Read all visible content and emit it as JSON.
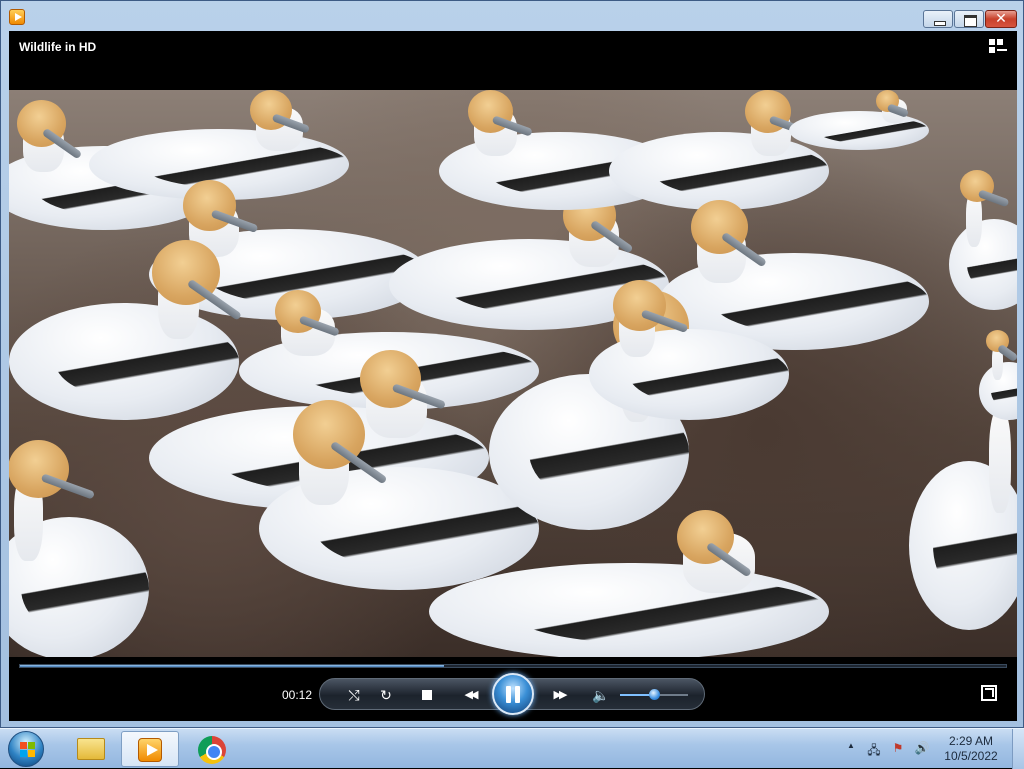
{
  "window": {
    "app_icon": "windows-media-player-icon",
    "controls": {
      "minimize": "minimize-icon",
      "maximize": "maximize-icon",
      "close": "close-icon",
      "close_glyph": "✕"
    }
  },
  "player": {
    "video_title": "Wildlife in HD",
    "library_switch_icon": "switch-to-library-icon",
    "elapsed_time": "00:12",
    "progress_fraction": 0.43,
    "volume_fraction": 0.5,
    "scene_subject": "gannets"
  },
  "controls": {
    "shuffle_glyph": "⤭",
    "repeat_glyph": "↻",
    "prev_glyph": "◀◀",
    "next_glyph": "▶▶",
    "mute_glyph": "🔈"
  },
  "taskbar": {
    "pinned": [
      "windows-explorer",
      "windows-media-player",
      "google-chrome"
    ],
    "tray": {
      "show_hidden_glyph": "▲",
      "network_glyph": "🖧",
      "action_center_glyph": "⚑",
      "volume_glyph": "🔊"
    },
    "time": "2:29 AM",
    "date": "10/5/2022"
  },
  "colors": {
    "accent": "#3f78b6",
    "taskbar": "#a8c6e8",
    "close_button": "#c8412b"
  }
}
